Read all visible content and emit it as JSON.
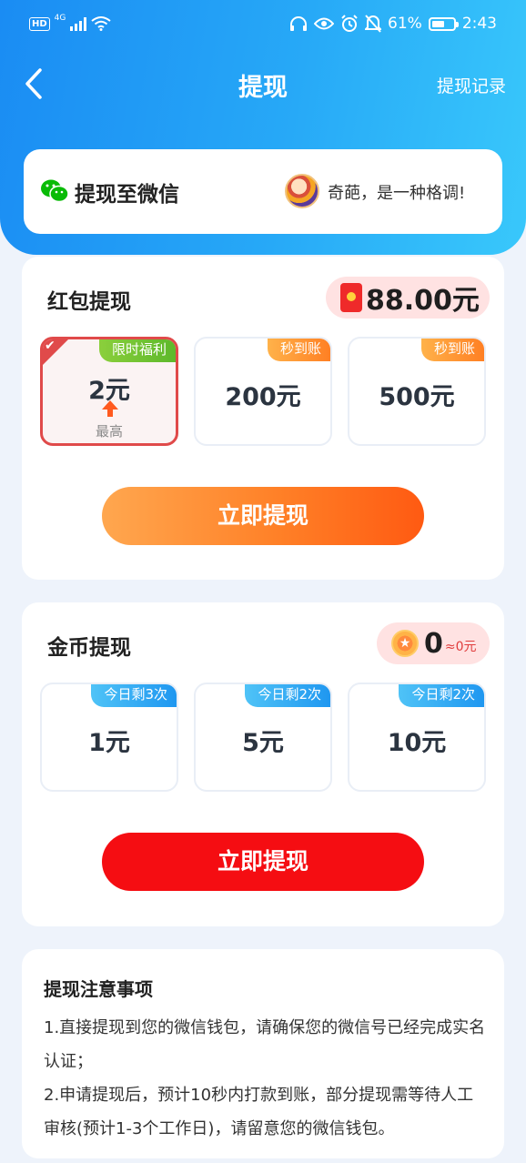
{
  "status_bar": {
    "hd": "HD",
    "network": "4G",
    "battery_percent": "61%",
    "time": "2:43"
  },
  "nav": {
    "title": "提现",
    "records": "提现记录"
  },
  "wechat": {
    "title": "提现至微信",
    "username": "奇葩，是一种格调!"
  },
  "red_packet": {
    "title": "红包提现",
    "balance": "88.00元",
    "options": [
      {
        "amount": "2元",
        "tag": "限时福利",
        "sub": "最高",
        "selected": true
      },
      {
        "amount": "200元",
        "tag": "秒到账",
        "selected": false
      },
      {
        "amount": "500元",
        "tag": "秒到账",
        "selected": false
      }
    ],
    "button": "立即提现"
  },
  "gold": {
    "title": "金币提现",
    "balance": "0",
    "approx": "≈0元",
    "options": [
      {
        "amount": "1元",
        "tag": "今日剩3次"
      },
      {
        "amount": "5元",
        "tag": "今日剩2次"
      },
      {
        "amount": "10元",
        "tag": "今日剩2次"
      }
    ],
    "button": "立即提现"
  },
  "notes": {
    "title": "提现注意事项",
    "lines": [
      "1.直接提现到您的微信钱包，请确保您的微信号已经完成实名认证；",
      "2.申请提现后，预计10秒内打款到账，部分提现需等待人工审核(预计1-3个工作日)，请留意您的微信钱包。"
    ]
  },
  "colors": {
    "header_gradient_start": "#1a8cf3",
    "header_gradient_end": "#39c8fb",
    "orange_button": "#ff7a22",
    "red_button": "#f50d12",
    "selected_border": "#e04a4a"
  }
}
